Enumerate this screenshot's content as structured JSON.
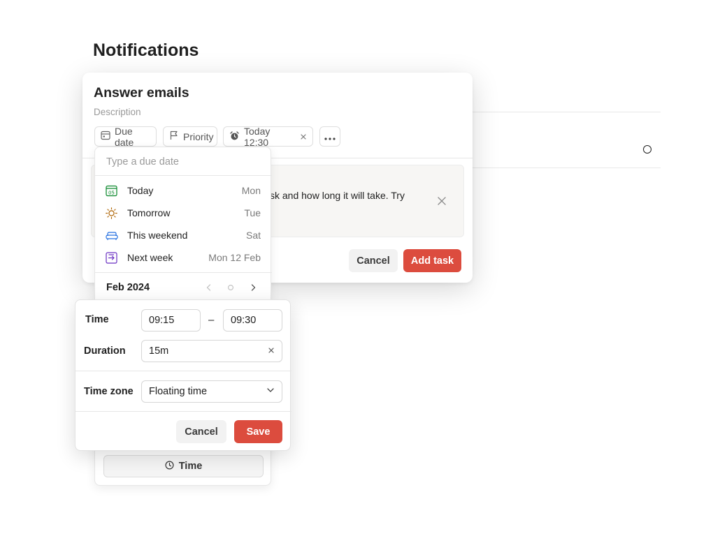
{
  "page": {
    "title": "Notifications"
  },
  "task": {
    "title": "Answer emails",
    "description_placeholder": "Description",
    "chips": {
      "due_date": "Due date",
      "priority": "Priority",
      "reminder": "Today 12:30"
    },
    "tip_text": "sk and how long it will take. Try",
    "cancel_label": "Cancel",
    "add_label": "Add task"
  },
  "due_dropdown": {
    "input_placeholder": "Type a due date",
    "options": [
      {
        "label": "Today",
        "day": "Mon",
        "icon": "calendar-today-icon",
        "color": "#058527"
      },
      {
        "label": "Tomorrow",
        "day": "Tue",
        "icon": "sun-icon",
        "color": "#ad6200"
      },
      {
        "label": "This weekend",
        "day": "Sat",
        "icon": "couch-icon",
        "color": "#246fe0"
      },
      {
        "label": "Next week",
        "day": "Mon 12 Feb",
        "icon": "next-week-icon",
        "color": "#692fc2"
      }
    ],
    "calendar_month": "Feb 2024",
    "time_button_label": "Time"
  },
  "time_popup": {
    "time_label": "Time",
    "start_time": "09:15",
    "dash": "–",
    "end_time": "09:30",
    "duration_label": "Duration",
    "duration_value": "15m",
    "timezone_label": "Time zone",
    "timezone_value": "Floating time",
    "cancel_label": "Cancel",
    "save_label": "Save"
  },
  "colors": {
    "accent": "#dc4c3e",
    "text": "#202020",
    "muted": "#9a9a9a"
  }
}
